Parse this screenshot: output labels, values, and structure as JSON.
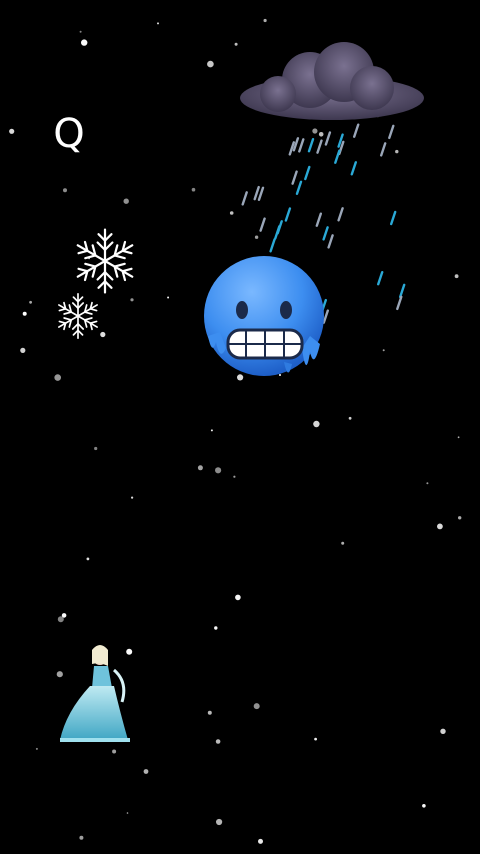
{
  "scene": {
    "background_color": "#000000",
    "theme": "frozen-night"
  },
  "search_button": {
    "icon": "search-icon",
    "glyph": "Q"
  },
  "emoji": {
    "name": "cold-face-icon",
    "color": "#3d8ef0"
  },
  "cloud": {
    "name": "storm-cloud-icon",
    "color": "#5a5366"
  },
  "snowflakes": [
    "snowflake-icon",
    "snowflake-icon"
  ],
  "character": {
    "name": "elsa-figure",
    "dress_color": "#7fd3e6"
  }
}
